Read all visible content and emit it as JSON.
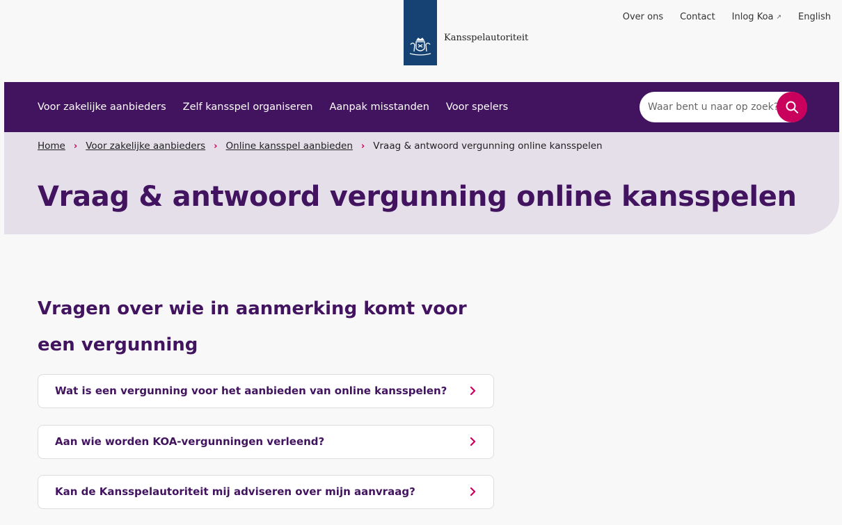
{
  "brand": {
    "name": "Kansspelautoriteit",
    "logo_color": "#154273"
  },
  "utility_nav": [
    {
      "label": "Over ons"
    },
    {
      "label": "Contact"
    },
    {
      "label": "Inlog Koa",
      "icon": "external-link-icon"
    },
    {
      "label": "English"
    }
  ],
  "main_nav": [
    {
      "label": "Voor zakelijke aanbieders"
    },
    {
      "label": "Zelf kansspel organiseren"
    },
    {
      "label": "Aanpak misstanden"
    },
    {
      "label": "Voor spelers"
    }
  ],
  "search": {
    "placeholder": "Waar bent u naar op zoek?",
    "icon": "search-icon"
  },
  "breadcrumb": [
    {
      "label": "Home"
    },
    {
      "label": "Voor zakelijke aanbieders"
    },
    {
      "label": "Online kansspel aanbieden"
    },
    {
      "label": "Vraag & antwoord vergunning online kansspelen"
    }
  ],
  "page_title": "Vraag & antwoord vergunning online kansspelen",
  "section": {
    "title": "Vragen over wie in aanmerking komt voor een vergunning",
    "questions": [
      {
        "label": "Wat is een vergunning voor het aanbieden van online kansspelen?"
      },
      {
        "label": "Aan wie worden KOA-vergunningen verleend?"
      },
      {
        "label": "Kan de Kansspelautoriteit mij adviseren over mijn aanvraag?"
      }
    ]
  },
  "colors": {
    "primary": "#42145f",
    "accent": "#ca005d",
    "hero_bg": "#e5dfea"
  }
}
